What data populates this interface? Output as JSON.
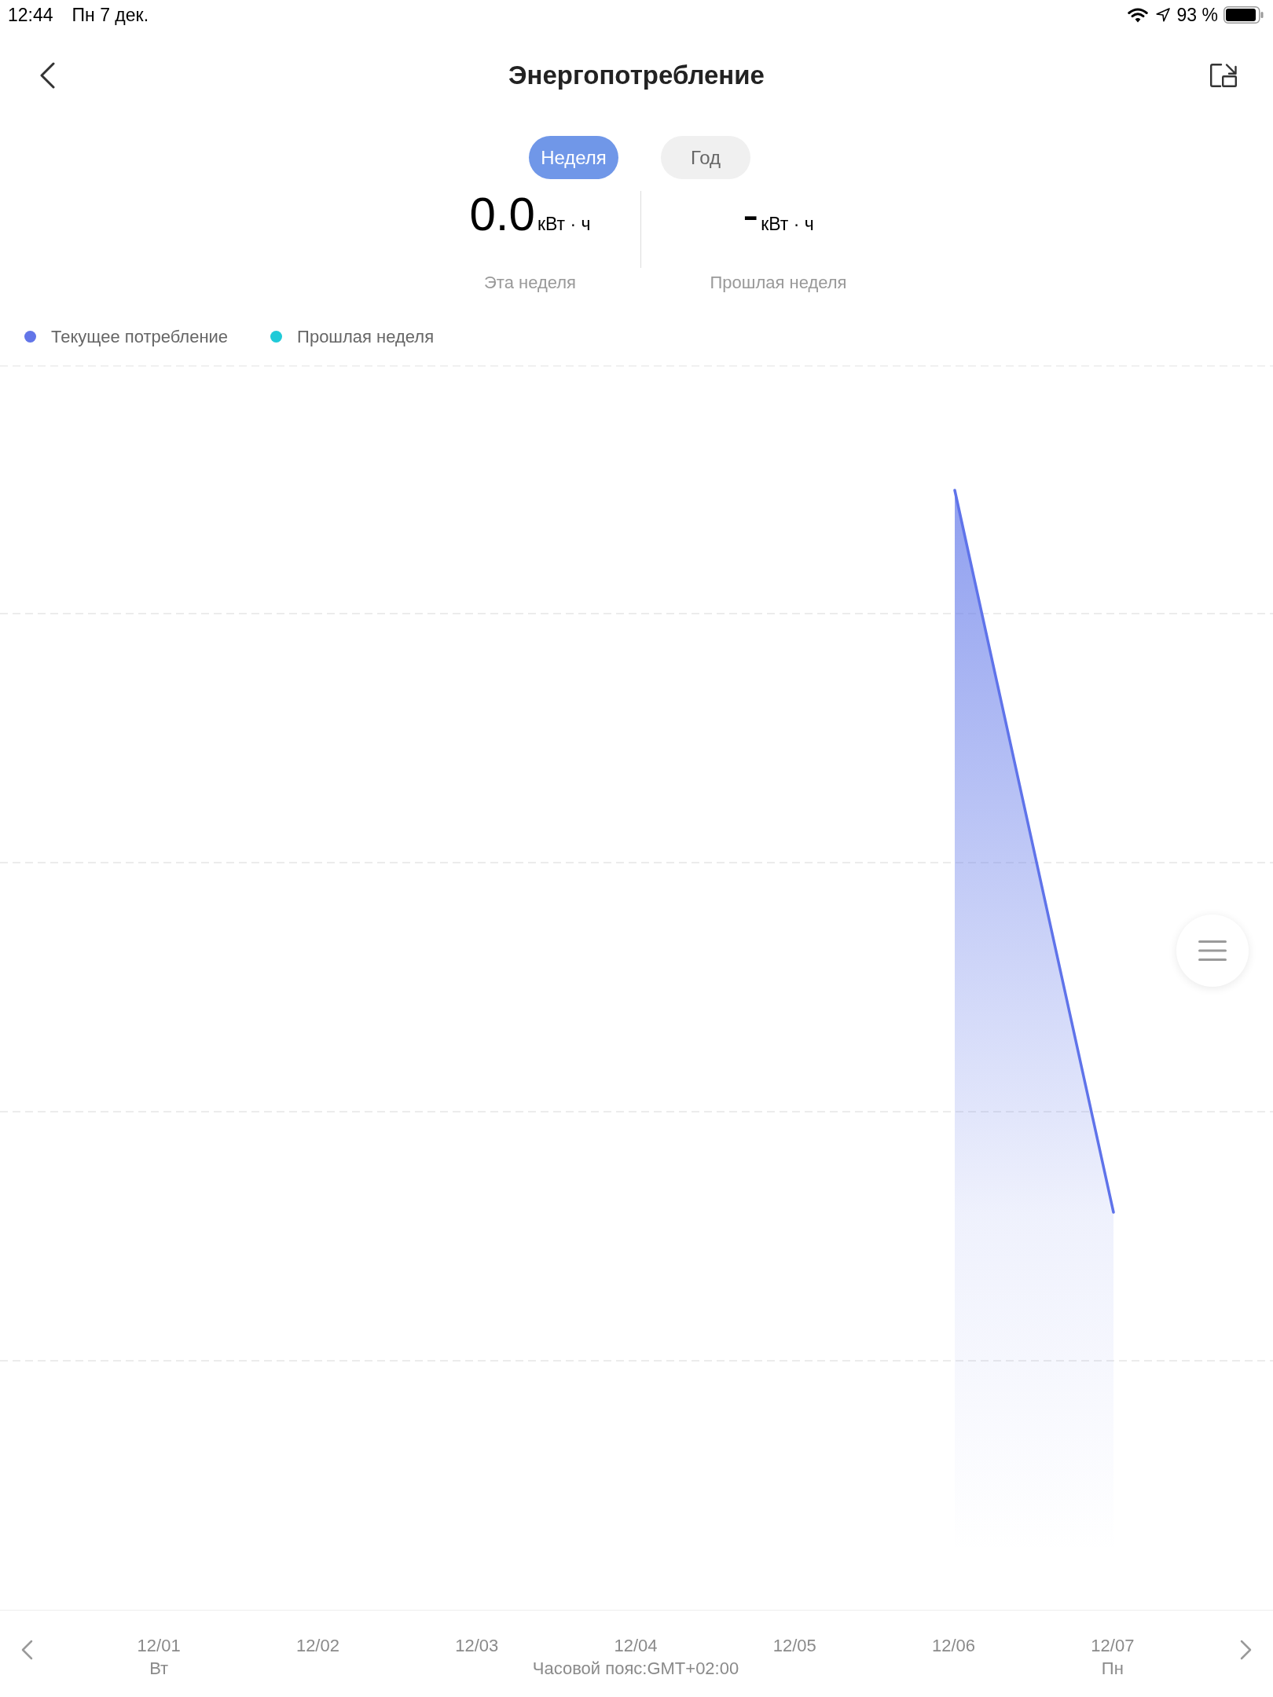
{
  "status_bar": {
    "time": "12:44",
    "date": "Пн 7 дек.",
    "battery": "93 %"
  },
  "header": {
    "title": "Энергопотребление"
  },
  "tabs": [
    {
      "label": "Неделя",
      "selected": true
    },
    {
      "label": "Год",
      "selected": false
    }
  ],
  "summary": [
    {
      "value": "0.0",
      "unit": "кВт · ч",
      "label": "Эта неделя"
    },
    {
      "value": "-",
      "unit": "кВт · ч",
      "label": "Прошлая неделя"
    }
  ],
  "legend": [
    {
      "label": "Текущее потребление",
      "color": "#6275e8"
    },
    {
      "label": "Прошлая неделя",
      "color": "#1fcad8"
    }
  ],
  "x_axis": {
    "labels": [
      {
        "date": "12/01",
        "weekday": "Вт"
      },
      {
        "date": "12/02"
      },
      {
        "date": "12/03"
      },
      {
        "date": "12/04"
      },
      {
        "date": "12/05"
      },
      {
        "date": "12/06"
      },
      {
        "date": "12/07",
        "weekday": "Пн"
      }
    ],
    "timezone": "Часовой пояс:GMT+02:00"
  }
}
